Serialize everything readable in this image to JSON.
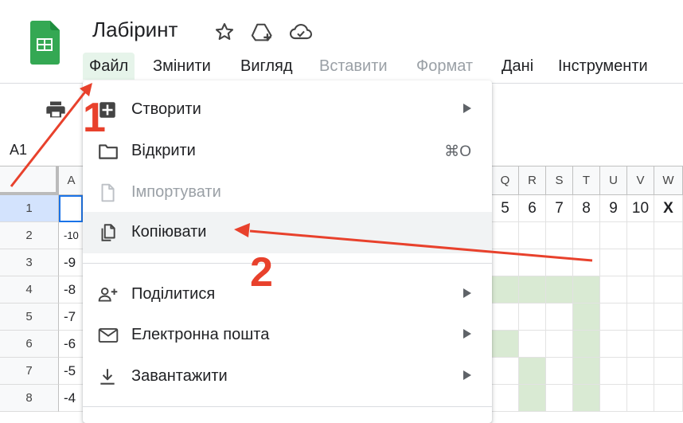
{
  "app": {
    "title": "Лабіринт"
  },
  "menubar": [
    {
      "label": "Файл",
      "state": "active"
    },
    {
      "label": "Змінити",
      "state": "normal"
    },
    {
      "label": "Вигляд",
      "state": "normal"
    },
    {
      "label": "Вставити",
      "state": "disabled"
    },
    {
      "label": "Формат",
      "state": "disabled"
    },
    {
      "label": "Дані",
      "state": "normal"
    },
    {
      "label": "Інструменти",
      "state": "normal"
    }
  ],
  "namebox": {
    "value": "A1"
  },
  "columns": [
    "A",
    "Q",
    "R",
    "S",
    "T",
    "U",
    "V",
    "W"
  ],
  "rows": [
    "1",
    "2",
    "3",
    "4",
    "5",
    "6",
    "7",
    "8"
  ],
  "column_a_values": [
    "",
    "-10",
    "-9",
    "-8",
    "-7",
    "-6",
    "-5",
    "-4"
  ],
  "row1_values": [
    "5",
    "6",
    "7",
    "8",
    "9",
    "10",
    "X"
  ],
  "file_menu": {
    "items": [
      {
        "label": "Створити",
        "icon": "plus-box-icon",
        "submenu": true
      },
      {
        "label": "Відкрити",
        "icon": "folder-icon",
        "shortcut": "⌘O"
      },
      {
        "label": "Імпортувати",
        "icon": "file-icon",
        "disabled": true
      },
      {
        "label": "Копіювати",
        "icon": "copy-icon",
        "highlighted": true
      },
      {
        "label": "Поділитися",
        "icon": "add-person-icon",
        "submenu": true
      },
      {
        "label": "Електронна пошта",
        "icon": "mail-icon",
        "submenu": true
      },
      {
        "label": "Завантажити",
        "icon": "download-icon",
        "submenu": true
      }
    ]
  },
  "annotations": {
    "step1": "1",
    "step2": "2"
  },
  "colors": {
    "accent": "#1a73e8",
    "annotation": "#e8412c",
    "maze": "#d9ead3",
    "active_menu": "#e6f4ea"
  }
}
